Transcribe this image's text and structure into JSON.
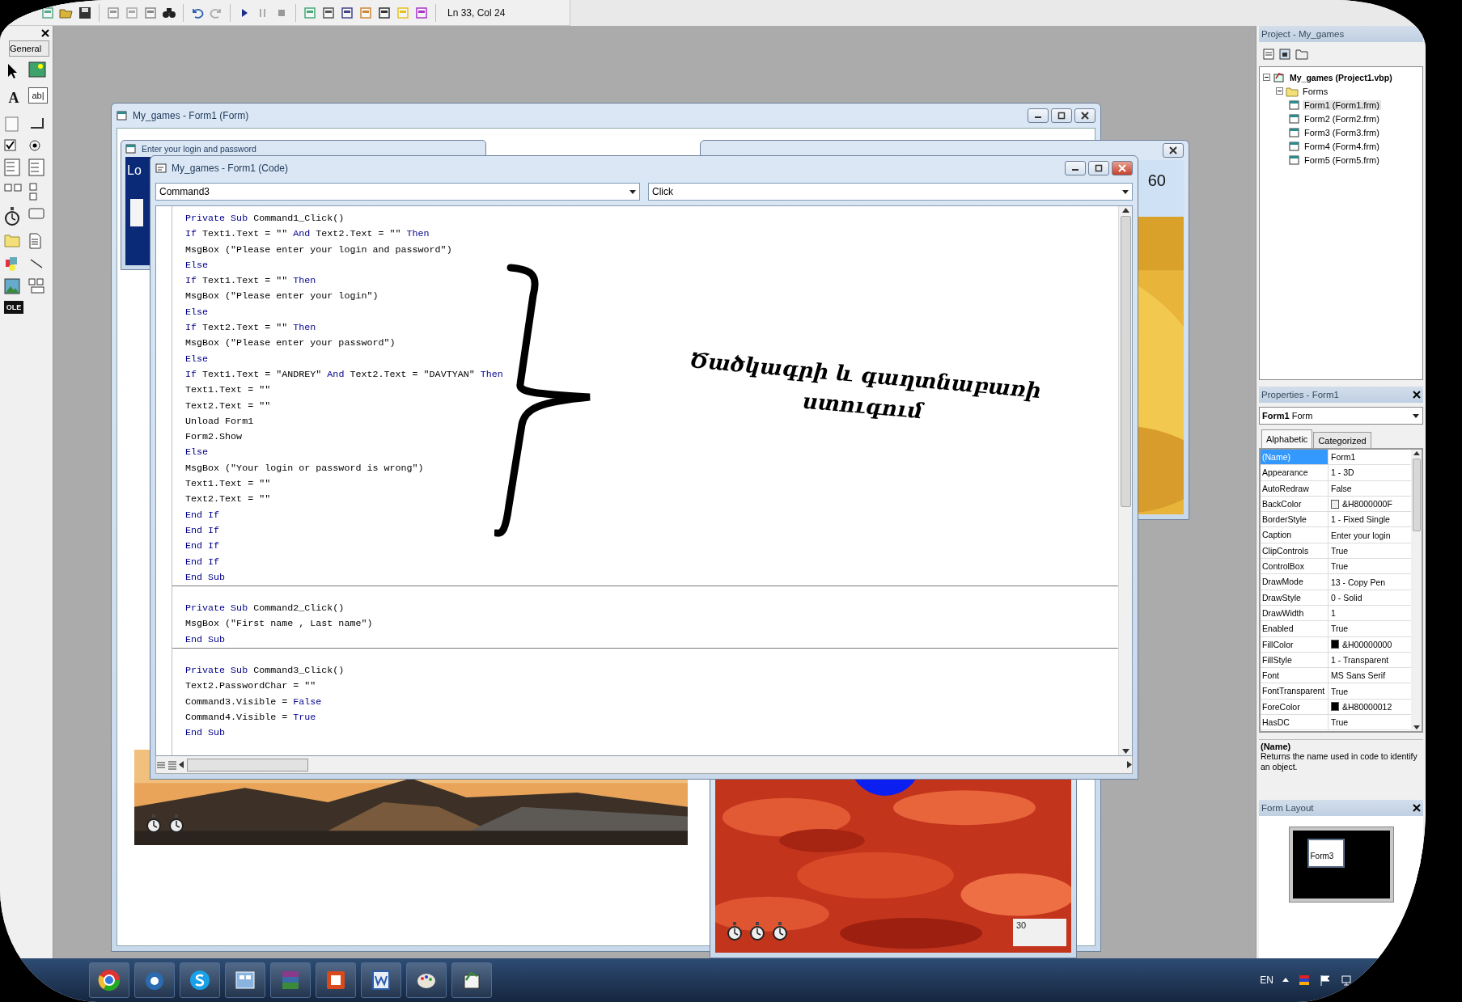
{
  "toolbar": {
    "status": "Ln 33, Col 24"
  },
  "toolbox": {
    "tab": "General",
    "label_glyph": "A",
    "textbox_glyph": "ab|",
    "ole_glyph": "OLE"
  },
  "form_window": {
    "title": "My_games - Form1 (Form)",
    "login_form": {
      "title": "Enter your login and password",
      "label": "Lo"
    }
  },
  "picture_form": {
    "label": "60"
  },
  "flower_form": {
    "field_value": "30"
  },
  "code_window": {
    "title": "My_games - Form1 (Code)",
    "object": "Command3",
    "procedure": "Click",
    "procedures": [
      {
        "lines": [
          [
            {
              "kind": "kw",
              "text": "Private Sub"
            },
            {
              "kind": "tx",
              "text": " Command1_Click()"
            }
          ],
          [
            {
              "kind": "kw",
              "text": "If"
            },
            {
              "kind": "tx",
              "text": " Text1.Text = \"\" "
            },
            {
              "kind": "kw",
              "text": "And"
            },
            {
              "kind": "tx",
              "text": " Text2.Text = \"\" "
            },
            {
              "kind": "kw",
              "text": "Then"
            }
          ],
          [
            {
              "kind": "tx",
              "text": "MsgBox (\"Please enter your login and password\")"
            }
          ],
          [
            {
              "kind": "kw",
              "text": "Else"
            }
          ],
          [
            {
              "kind": "kw",
              "text": "If"
            },
            {
              "kind": "tx",
              "text": " Text1.Text = \"\" "
            },
            {
              "kind": "kw",
              "text": "Then"
            }
          ],
          [
            {
              "kind": "tx",
              "text": "MsgBox (\"Please enter your login\")"
            }
          ],
          [
            {
              "kind": "kw",
              "text": "Else"
            }
          ],
          [
            {
              "kind": "kw",
              "text": "If"
            },
            {
              "kind": "tx",
              "text": " Text2.Text = \"\" "
            },
            {
              "kind": "kw",
              "text": "Then"
            }
          ],
          [
            {
              "kind": "tx",
              "text": "MsgBox (\"Please enter your password\")"
            }
          ],
          [
            {
              "kind": "kw",
              "text": "Else"
            }
          ],
          [
            {
              "kind": "kw",
              "text": "If"
            },
            {
              "kind": "tx",
              "text": " Text1.Text = \"ANDREY\" "
            },
            {
              "kind": "kw",
              "text": "And"
            },
            {
              "kind": "tx",
              "text": " Text2.Text = \"DAVTYAN\" "
            },
            {
              "kind": "kw",
              "text": "Then"
            }
          ],
          [
            {
              "kind": "tx",
              "text": "Text1.Text = \"\""
            }
          ],
          [
            {
              "kind": "tx",
              "text": "Text2.Text = \"\""
            }
          ],
          [
            {
              "kind": "tx",
              "text": "Unload Form1"
            }
          ],
          [
            {
              "kind": "tx",
              "text": "Form2.Show"
            }
          ],
          [
            {
              "kind": "kw",
              "text": "Else"
            }
          ],
          [
            {
              "kind": "tx",
              "text": "MsgBox (\"Your login or password is wrong\")"
            }
          ],
          [
            {
              "kind": "tx",
              "text": "Text1.Text = \"\""
            }
          ],
          [
            {
              "kind": "tx",
              "text": "Text2.Text = \"\""
            }
          ],
          [
            {
              "kind": "kw",
              "text": "End If"
            }
          ],
          [
            {
              "kind": "kw",
              "text": "End If"
            }
          ],
          [
            {
              "kind": "kw",
              "text": "End If"
            }
          ],
          [
            {
              "kind": "kw",
              "text": "End If"
            }
          ],
          [
            {
              "kind": "kw",
              "text": "End Sub"
            }
          ]
        ]
      },
      {
        "lines": [
          [
            {
              "kind": "kw",
              "text": "Private Sub"
            },
            {
              "kind": "tx",
              "text": " Command2_Click()"
            }
          ],
          [
            {
              "kind": "tx",
              "text": "MsgBox (\"First name , Last name\")"
            }
          ],
          [
            {
              "kind": "kw",
              "text": "End Sub"
            }
          ]
        ]
      },
      {
        "lines": [
          [
            {
              "kind": "kw",
              "text": "Private Sub"
            },
            {
              "kind": "tx",
              "text": " Command3_Click()"
            }
          ],
          [
            {
              "kind": "tx",
              "text": "Text2.PasswordChar = \"\""
            }
          ],
          [
            {
              "kind": "tx",
              "text": "Command3.Visible = "
            },
            {
              "kind": "kw",
              "text": "False"
            }
          ],
          [
            {
              "kind": "tx",
              "text": "Command4.Visible = "
            },
            {
              "kind": "kw",
              "text": "True"
            }
          ],
          [
            {
              "kind": "kw",
              "text": "End Sub"
            }
          ]
        ]
      }
    ]
  },
  "annotation": {
    "text": "Ծածկագրի և գաղտնաբառի ստուգում"
  },
  "project": {
    "title": "Project - My_games",
    "tree": [
      {
        "label": "My_games (Project1.vbp)",
        "expanded": true,
        "selected": false,
        "children": [
          {
            "label": "Forms",
            "expanded": true,
            "selected": false,
            "children": [
              {
                "label": "Form1 (Form1.frm)",
                "selected": true
              },
              {
                "label": "Form2 (Form2.frm)",
                "selected": false
              },
              {
                "label": "Form3 (Form3.frm)",
                "selected": false
              },
              {
                "label": "Form4 (Form4.frm)",
                "selected": false
              },
              {
                "label": "Form5 (Form5.frm)",
                "selected": false
              }
            ]
          }
        ]
      }
    ]
  },
  "properties": {
    "title": "Properties - Form1",
    "object": "Form1",
    "object_type": "Form",
    "tabs": [
      {
        "label": "Alphabetic",
        "selected": true
      },
      {
        "label": "Categorized",
        "selected": false
      }
    ],
    "rows": [
      {
        "name": "(Name)",
        "value": "Form1",
        "selected": true
      },
      {
        "name": "Appearance",
        "value": "1 - 3D",
        "selected": false
      },
      {
        "name": "AutoRedraw",
        "value": "False",
        "selected": false
      },
      {
        "name": "BackColor",
        "value": "&H8000000F",
        "color": "#f0f0f0",
        "selected": false
      },
      {
        "name": "BorderStyle",
        "value": "1 - Fixed Single",
        "selected": false
      },
      {
        "name": "Caption",
        "value": "Enter your login",
        "selected": false
      },
      {
        "name": "ClipControls",
        "value": "True",
        "selected": false
      },
      {
        "name": "ControlBox",
        "value": "True",
        "selected": false
      },
      {
        "name": "DrawMode",
        "value": "13 - Copy Pen",
        "selected": false
      },
      {
        "name": "DrawStyle",
        "value": "0 - Solid",
        "selected": false
      },
      {
        "name": "DrawWidth",
        "value": "1",
        "selected": false
      },
      {
        "name": "Enabled",
        "value": "True",
        "selected": false
      },
      {
        "name": "FillColor",
        "value": "&H00000000",
        "color": "#000000",
        "selected": false
      },
      {
        "name": "FillStyle",
        "value": "1 - Transparent",
        "selected": false
      },
      {
        "name": "Font",
        "value": "MS Sans Serif",
        "selected": false
      },
      {
        "name": "FontTransparent",
        "value": "True",
        "selected": false
      },
      {
        "name": "ForeColor",
        "value": "&H80000012",
        "color": "#000000",
        "selected": false
      },
      {
        "name": "HasDC",
        "value": "True",
        "selected": false
      }
    ],
    "description_title": "(Name)",
    "description": "Returns the name used in code to identify an object."
  },
  "form_layout": {
    "title": "Form Layout",
    "form_label": "Form3"
  },
  "taskbar": {
    "language": "EN"
  }
}
